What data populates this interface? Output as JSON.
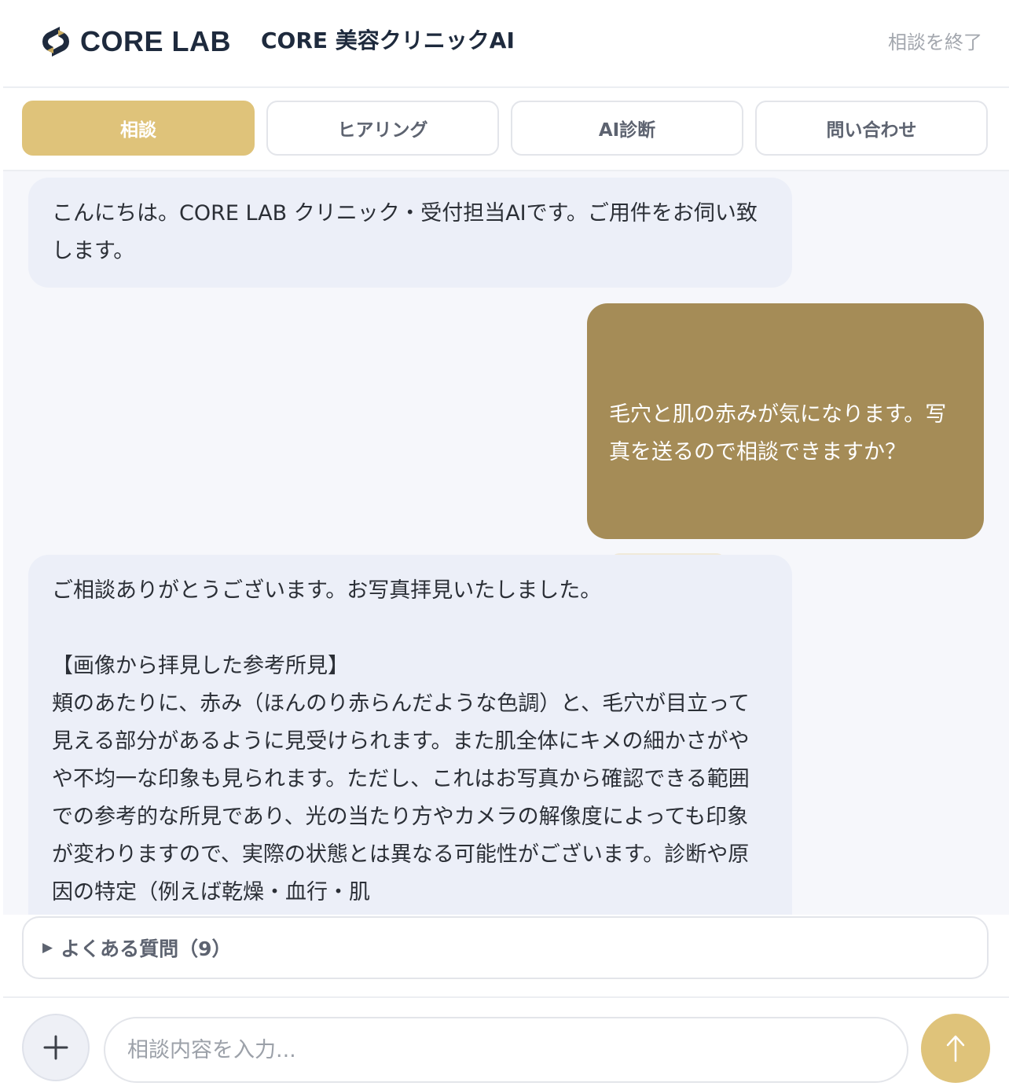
{
  "header": {
    "logo_text": "CORE LAB",
    "title": "CORE 美容クリニックAI",
    "end_label": "相談を終了"
  },
  "tabs": [
    {
      "label": "相談",
      "active": true
    },
    {
      "label": "ヒアリング",
      "active": false
    },
    {
      "label": "AI診断",
      "active": false
    },
    {
      "label": "問い合わせ",
      "active": false
    }
  ],
  "messages": [
    {
      "role": "assistant",
      "text": "こんにちは。CORE LAB クリニック・受付担当AIです。ご用件をお伺い致します。"
    },
    {
      "role": "user",
      "text": "毛穴と肌の赤みが気になります。写真を送るので相談できますか？",
      "has_image": true
    },
    {
      "role": "assistant",
      "text": "ご相談ありがとうございます。お写真拝見いたしました。\n\n【画像から拝見した参考所見】\n頬のあたりに、赤み（ほんのり赤らんだような色調）と、毛穴が目立って見える部分があるように見受けられます。また肌全体にキメの細かさがやや不均一な印象も見られます。ただし、これはお写真から確認できる範囲での参考的な所見であり、光の当たり方やカメラの解像度によっても印象が変わりますので、実際の状態とは異なる可能性がございます。診断や原因の特定（例えば乾燥・血行・肌"
    }
  ],
  "faq": {
    "label": "よくある質問（9）"
  },
  "composer": {
    "placeholder": "相談内容を入力...",
    "plus_icon": "plus-icon",
    "send_icon": "arrow-up-icon"
  },
  "colors": {
    "accent": "#dfc37a",
    "user_bubble": "#a58c57",
    "bot_bubble": "#eceff8",
    "chat_bg": "#f6f7fb"
  }
}
